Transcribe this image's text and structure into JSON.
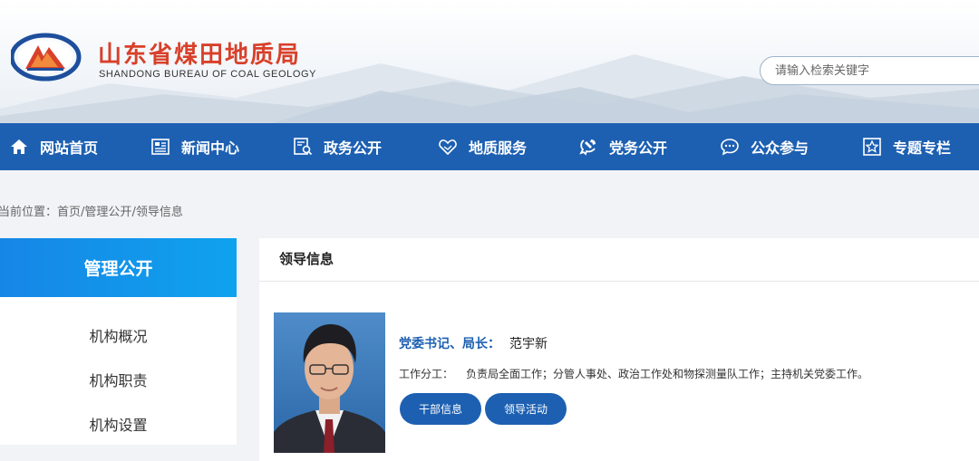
{
  "header": {
    "title": "山东省煤田地质局",
    "subtitle": "SHANDONG BUREAU OF COAL GEOLOGY",
    "logo_icon": "bureau-logo-icon",
    "search_placeholder": "请输入检索关键字"
  },
  "nav": {
    "items": [
      {
        "label": "网站首页",
        "icon": "home-icon"
      },
      {
        "label": "新闻中心",
        "icon": "newspaper-icon"
      },
      {
        "label": "政务公开",
        "icon": "document-search-icon"
      },
      {
        "label": "地质服务",
        "icon": "handshake-icon"
      },
      {
        "label": "党务公开",
        "icon": "party-emblem-icon"
      },
      {
        "label": "公众参与",
        "icon": "chat-icon"
      },
      {
        "label": "专题专栏",
        "icon": "star-icon"
      }
    ]
  },
  "breadcrumb": {
    "prefix": "当前位置：",
    "home": "首页",
    "sep": "/",
    "section": "管理公开",
    "current": "领导信息"
  },
  "sidebar": {
    "title": "管理公开",
    "items": [
      "机构概况",
      "机构职责",
      "机构设置"
    ]
  },
  "main": {
    "title": "领导信息",
    "leader": {
      "role": "党委书记、局长：",
      "name": "范宇新",
      "duty_label": "工作分工：",
      "duty": "负责局全面工作；分管人事处、政治工作处和物探测量队工作；主持机关党委工作。"
    },
    "buttons": [
      "干部信息",
      "领导活动"
    ]
  },
  "colors": {
    "brand_red": "#d8402a",
    "nav_blue": "#1d60b2",
    "sidebar_gradient_start": "#1686e6",
    "sidebar_gradient_end": "#0fa2ee"
  }
}
